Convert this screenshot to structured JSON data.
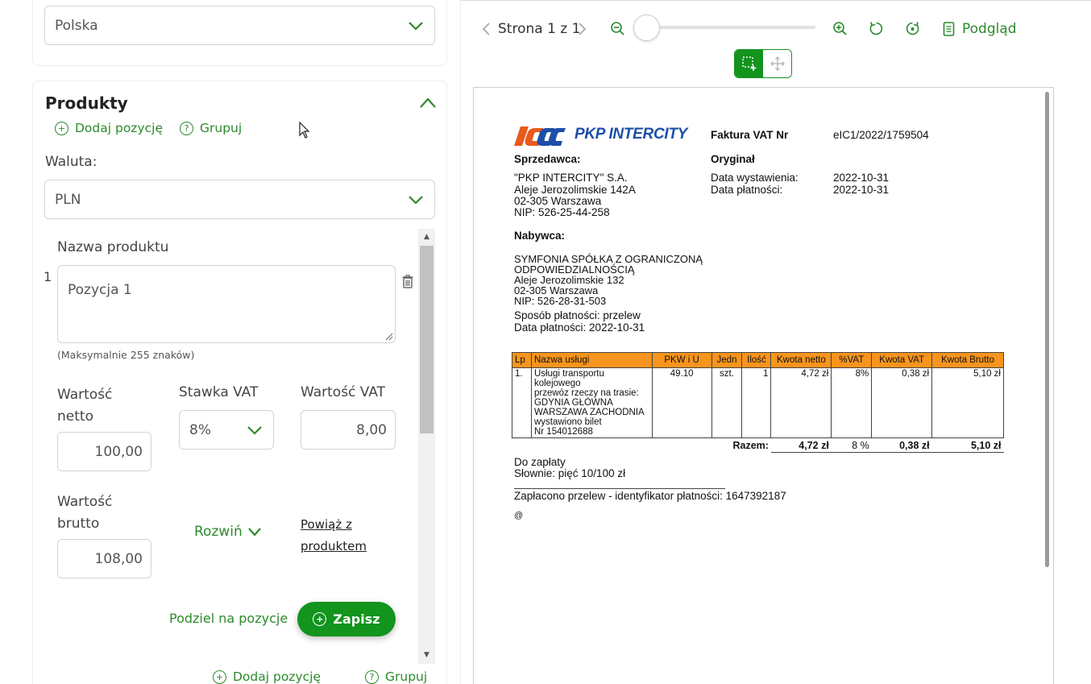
{
  "country_select": {
    "value": "Polska"
  },
  "products": {
    "title": "Produkty",
    "add_item": "Dodaj pozycję",
    "group": "Grupuj",
    "currency_label": "Waluta:",
    "currency_value": "PLN",
    "product_name_label": "Nazwa produktu",
    "item_index": "1",
    "item_name": "Pozycja 1",
    "max_chars_note": "(Maksymalnie 255 znaków)",
    "net_value_label": "Wartość netto",
    "vat_rate_label": "Stawka VAT",
    "vat_value_label": "Wartość VAT",
    "net_value": "100,00",
    "vat_rate": "8%",
    "vat_value": "8,00",
    "gross_value_label": "Wartość brutto",
    "gross_value": "108,00",
    "expand": "Rozwiń",
    "link_product": "Powiąż z produktem",
    "split": "Podziel na pozycje",
    "save": "Zapisz",
    "bottom_add_item": "Dodaj pozycję",
    "bottom_group": "Grupuj"
  },
  "viewer": {
    "page_label": "Strona 1 z 1",
    "preview": "Podgląd",
    "zoom_level": 0
  },
  "invoice": {
    "logo_text": "PKP INTERCITY",
    "title": "Faktura VAT Nr",
    "number": "eIC1/2022/1759504",
    "seller_label": "Sprzedawca:",
    "original": "Oryginał",
    "seller_name": "\"PKP INTERCITY\" S.A.",
    "seller_street": "Aleje Jerozolimskie 142A",
    "seller_city": "02-305 Warszawa",
    "seller_nip": "NIP: 526-25-44-258",
    "issue_date_label": "Data wystawienia:",
    "issue_date": "2022-10-31",
    "payment_date_label": "Data płatności:",
    "payment_date": "2022-10-31",
    "buyer_label": "Nabywca:",
    "buyer_name_1": "SYMFONIA SPÓŁKA Z OGRANICZONĄ",
    "buyer_name_2": "ODPOWIEDZIALNOŚCIĄ",
    "buyer_street": "Aleje Jerozolimskie 132",
    "buyer_city": "02-305 Warszawa",
    "buyer_nip": "NIP: 526-28-31-503",
    "payment_method": "Sposób płatności: przelew",
    "payment_date_line": "Data płatności: 2022-10-31",
    "table_headers": [
      "Lp",
      "Nazwa usługi",
      "PKW i U",
      "Jedn",
      "Ilość",
      "Kwota netto",
      "%VAT",
      "Kwota VAT",
      "Kwota Brutto"
    ],
    "row": {
      "lp": "1.",
      "name": "Usługi transportu\nkolejowego\nprzewóz rzeczy na trasie:\nGDYNIA GŁÓWNA\nWARSZAWA ZACHODNIA\nwystawiono bilet\nNr 154012688",
      "pkwiu": "49.10",
      "unit": "szt.",
      "qty": "1",
      "net": "4,72 zł",
      "vat_pct": "8%",
      "vat": "0,38 zł",
      "gross": "5,10 zł"
    },
    "sum_label": "Razem:",
    "sum_net": "4,72 zł",
    "sum_vat_pct": "8 %",
    "sum_vat": "0,38 zł",
    "sum_gross": "5,10 zł",
    "to_pay": "Do zapłaty",
    "in_words": "Słownie: pięć 10/100 zł",
    "paid_note": "Zapłacono przelew - identyfikator płatności: 1647392187",
    "at_sign": "@"
  },
  "colors": {
    "accent": "#12941d",
    "link_green": "#2c8a2c",
    "table_header": "#f7941d",
    "logo_blue": "#1d4fa8"
  }
}
